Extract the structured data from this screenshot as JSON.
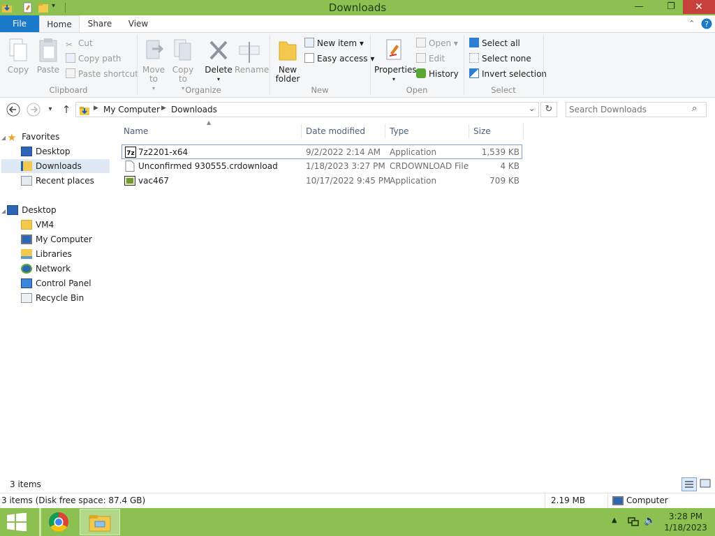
{
  "window": {
    "title": "Downloads",
    "minimize_glyph": "—",
    "restore_glyph": "❐",
    "close_glyph": "✕"
  },
  "tabs": {
    "file": "File",
    "home": "Home",
    "share": "Share",
    "view": "View"
  },
  "ribbon": {
    "clipboard": {
      "copy": "Copy",
      "paste": "Paste",
      "cut": "Cut",
      "copy_path": "Copy path",
      "paste_shortcut": "Paste shortcut",
      "label": "Clipboard"
    },
    "organize": {
      "move_to": "Move to",
      "copy_to": "Copy to",
      "delete": "Delete",
      "rename": "Rename",
      "label": "Organize"
    },
    "new": {
      "new_folder": "New folder",
      "new_item": "New item",
      "easy_access": "Easy access",
      "label": "New"
    },
    "open": {
      "properties": "Properties",
      "open": "Open",
      "edit": "Edit",
      "history": "History",
      "label": "Open"
    },
    "select": {
      "select_all": "Select all",
      "select_none": "Select none",
      "invert": "Invert selection",
      "label": "Select"
    }
  },
  "address": {
    "crumbs": [
      "My Computer",
      "Downloads"
    ]
  },
  "search": {
    "placeholder": "Search Downloads"
  },
  "nav": {
    "favorites": "Favorites",
    "favorites_items": [
      "Desktop",
      "Downloads",
      "Recent places"
    ],
    "desktop": "Desktop",
    "desktop_items": [
      "VM4",
      "My Computer",
      "Libraries",
      "Network",
      "Control Panel",
      "Recycle Bin"
    ]
  },
  "columns": {
    "name": "Name",
    "date": "Date modified",
    "type": "Type",
    "size": "Size"
  },
  "files": [
    {
      "name": "7z2201-x64",
      "date": "9/2/2022 2:14 AM",
      "type": "Application",
      "size": "1,539 KB",
      "icon": "7zip-icon"
    },
    {
      "name": "Unconfirmed 930555.crdownload",
      "date": "1/18/2023 3:27 PM",
      "type": "CRDOWNLOAD File",
      "size": "4 KB",
      "icon": "blank-file-icon"
    },
    {
      "name": "vac467",
      "date": "10/17/2022 9:45 PM",
      "type": "Application",
      "size": "709 KB",
      "icon": "app-icon"
    }
  ],
  "status": {
    "item_count": "3 items",
    "disk": "3 items (Disk free space: 87.4 GB)",
    "size": "2.19 MB",
    "location": "Computer"
  },
  "clock": {
    "time": "3:28 PM",
    "date": "1/18/2023"
  }
}
